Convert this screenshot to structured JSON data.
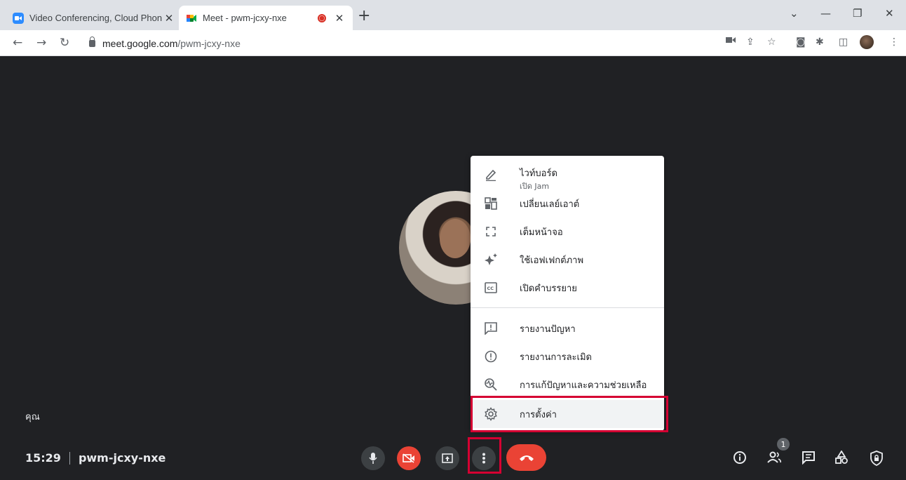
{
  "browser": {
    "tabs": [
      {
        "title": "Video Conferencing, Cloud Phon",
        "favicon": "zoom-icon"
      },
      {
        "title": "Meet - pwm-jcxy-nxe",
        "favicon": "google-meet-icon"
      }
    ],
    "url_host": "meet.google.com",
    "url_path": "/pwm-jcxy-nxe"
  },
  "meeting": {
    "you_label": "คุณ",
    "time": "15:29",
    "code": "pwm-jcxy-nxe",
    "participants_count": "1"
  },
  "menu": {
    "items": [
      {
        "label": "ไวท์บอร์ด",
        "sub": "เปิด Jam",
        "icon": "pencil-icon"
      },
      {
        "label": "เปลี่ยนเลย์เอาต์",
        "icon": "layout-icon"
      },
      {
        "label": "เต็มหน้าจอ",
        "icon": "fullscreen-icon"
      },
      {
        "label": "ใช้เอฟเฟกต์ภาพ",
        "icon": "sparkle-icon"
      },
      {
        "label": "เปิดคำบรรยาย",
        "icon": "captions-icon"
      },
      {
        "label": "รายงานปัญหา",
        "icon": "feedback-icon"
      },
      {
        "label": "รายงานการละเมิด",
        "icon": "report-icon"
      },
      {
        "label": "การแก้ปัญหาและความช่วยเหลือ",
        "icon": "troubleshoot-icon"
      },
      {
        "label": "การตั้งค่า",
        "icon": "gear-icon"
      }
    ]
  },
  "colors": {
    "meet_bg": "#202124",
    "end_call": "#ea4335",
    "highlight": "#d50032"
  }
}
